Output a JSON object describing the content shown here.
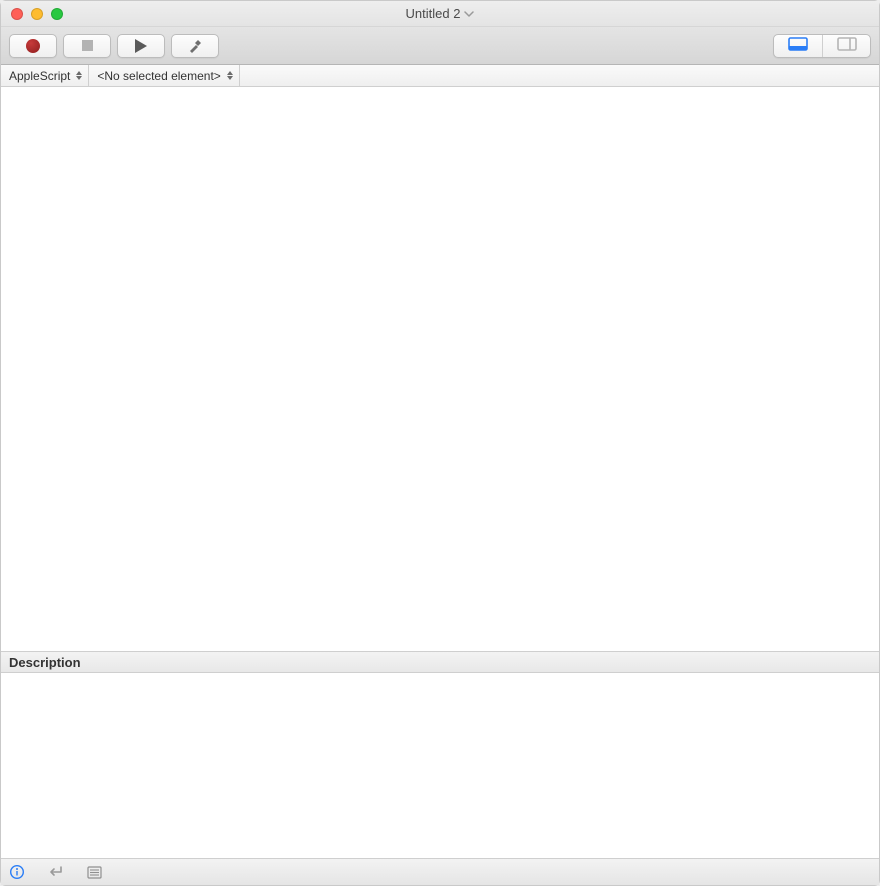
{
  "window": {
    "title": "Untitled 2"
  },
  "toolbar": {
    "record_label": "Record",
    "stop_label": "Stop",
    "run_label": "Run",
    "compile_label": "Compile",
    "view_editor_label": "Show editor",
    "view_split_label": "Show split"
  },
  "navbar": {
    "language": "AppleScript",
    "element": "<No selected element>"
  },
  "panels": {
    "description_header": "Description"
  },
  "statusbar": {
    "info_label": "Info",
    "reply_label": "Return",
    "log_label": "Log"
  },
  "colors": {
    "accent": "#2a7df6"
  }
}
